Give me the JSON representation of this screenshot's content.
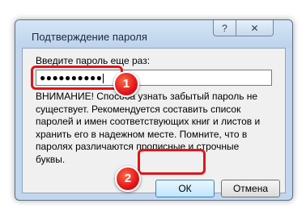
{
  "dialog": {
    "title": "Подтверждение пароля",
    "help_button": "?",
    "close_button": "✕",
    "prompt_label": "Введите пароль еще раз:",
    "password_value": "●●●●●●●●●●",
    "warning_text": "ВНИМАНИЕ! Способа узнать забытый пароль не существует. Рекомендуется составить список паролей и имен соответствующих книг и листов и хранить его в надежном месте. Помните, что в паролях различаются прописные и строчные буквы.",
    "ok_button": "ОК",
    "cancel_button": "Отмена"
  },
  "annotations": {
    "step1": "1",
    "step2": "2",
    "highlight_color": "#e0151b"
  }
}
